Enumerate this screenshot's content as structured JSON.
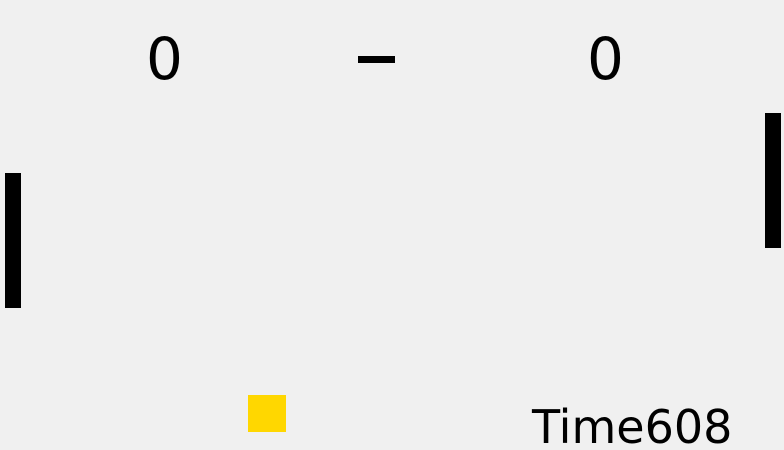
{
  "game": {
    "score_left": "0",
    "score_separator": "–",
    "score_right": "0",
    "timer_label": "Time",
    "timer_value": "608",
    "ball_color": "#ffd700",
    "paddle_color": "#000000",
    "background_color": "#f0f0f0"
  }
}
